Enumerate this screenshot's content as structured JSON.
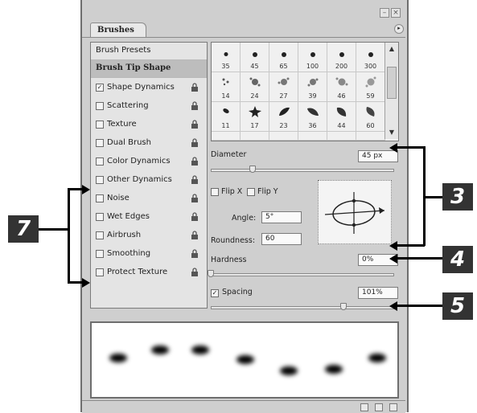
{
  "panel": {
    "tab_label": "Brushes",
    "window_buttons": [
      "–",
      "×"
    ],
    "menu_arrow": "▸"
  },
  "left_list": {
    "presets_label": "Brush Presets",
    "tip_shape_label": "Brush Tip Shape",
    "options": [
      {
        "label": "Shape Dynamics",
        "checked": true
      },
      {
        "label": "Scattering",
        "checked": false
      },
      {
        "label": "Texture",
        "checked": false
      },
      {
        "label": "Dual Brush",
        "checked": false
      },
      {
        "label": "Color Dynamics",
        "checked": false
      },
      {
        "label": "Other Dynamics",
        "checked": false
      },
      {
        "label": "Noise",
        "checked": false
      },
      {
        "label": "Wet Edges",
        "checked": false
      },
      {
        "label": "Airbrush",
        "checked": false
      },
      {
        "label": "Smoothing",
        "checked": false
      },
      {
        "label": "Protect Texture",
        "checked": false
      }
    ]
  },
  "brush_grid": {
    "row1": [
      "35",
      "45",
      "65",
      "100",
      "200",
      "300"
    ],
    "row2": [
      "14",
      "24",
      "27",
      "39",
      "46",
      "59"
    ],
    "row3": [
      "11",
      "17",
      "23",
      "36",
      "44",
      "60"
    ]
  },
  "settings": {
    "diameter_label": "Diameter",
    "diameter_value": "45 px",
    "flip_x_label": "Flip X",
    "flip_y_label": "Flip Y",
    "angle_label": "Angle:",
    "angle_value": "5°",
    "roundness_label": "Roundness:",
    "roundness_value": "60",
    "hardness_label": "Hardness",
    "hardness_value": "0%",
    "spacing_label": "Spacing",
    "spacing_value": "101%",
    "spacing_checked": true
  },
  "callouts": {
    "three": "3",
    "four": "4",
    "five": "5",
    "seven": "7"
  },
  "colors": {
    "panel_bg": "#cfcfcf",
    "list_bg": "#e4e4e4",
    "callout_bg": "#333333",
    "selected_row": "#bdbdbd"
  }
}
